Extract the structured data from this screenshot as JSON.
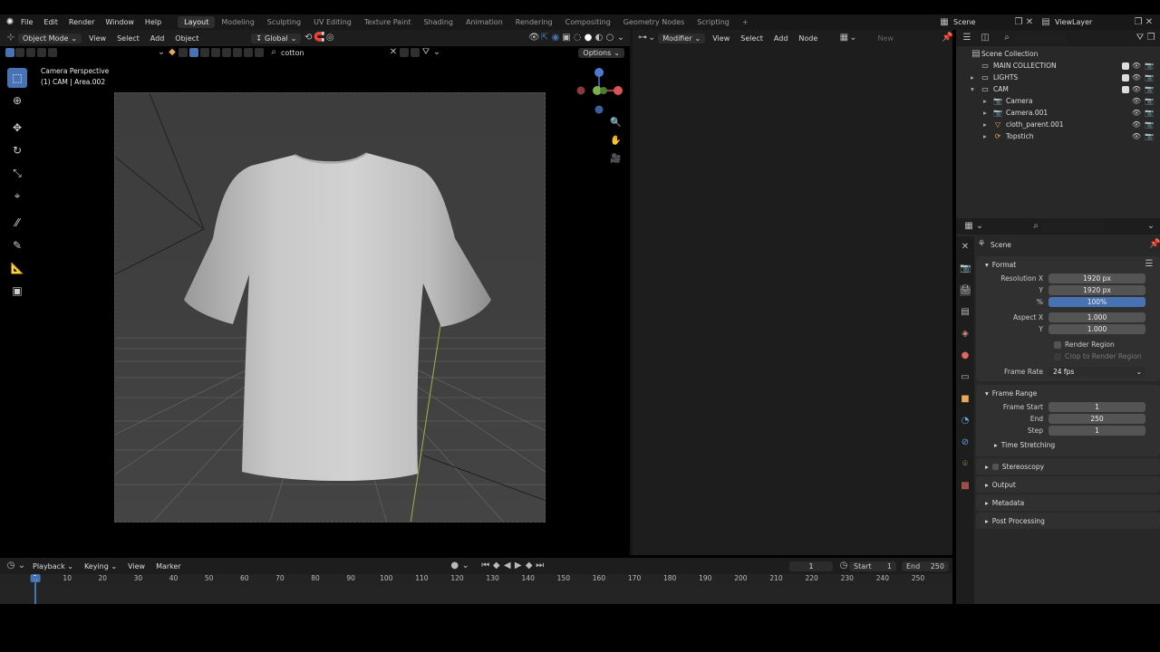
{
  "menu": {
    "items": [
      "File",
      "Edit",
      "Render",
      "Window",
      "Help"
    ],
    "workspaces": [
      "Layout",
      "Modeling",
      "Sculpting",
      "UV Editing",
      "Texture Paint",
      "Shading",
      "Animation",
      "Rendering",
      "Compositing",
      "Geometry Nodes",
      "Scripting"
    ],
    "active_workspace": "Layout",
    "add_tab": "+",
    "scene": "Scene",
    "view_layer": "ViewLayer"
  },
  "viewport": {
    "mode": "Object Mode",
    "menus": [
      "View",
      "Select",
      "Add",
      "Object"
    ],
    "transform": "Global",
    "search_value": "cotton",
    "options_label": "Options",
    "overlay_title": "Camera Perspective",
    "overlay_subtitle": "(1) CAM | Area.002"
  },
  "node_editor": {
    "type": "Modifier",
    "menus": [
      "View",
      "Select",
      "Add",
      "Node"
    ],
    "new_label": "New"
  },
  "outliner": {
    "root": "Scene Collection",
    "items": [
      {
        "label": "MAIN COLLECTION",
        "indent": 0,
        "icon": "collection-icon",
        "arrow": ""
      },
      {
        "label": "LIGHTS",
        "indent": 0,
        "icon": "collection-icon",
        "arrow": "▸"
      },
      {
        "label": "CAM",
        "indent": 0,
        "icon": "collection-icon",
        "arrow": "▾"
      },
      {
        "label": "Camera",
        "indent": 1,
        "icon": "camera-icon",
        "arrow": "▸"
      },
      {
        "label": "Camera.001",
        "indent": 1,
        "icon": "camera-icon",
        "arrow": "▸"
      },
      {
        "label": "cloth_parent.001",
        "indent": 1,
        "icon": "mesh-icon",
        "arrow": "▸"
      },
      {
        "label": "Topstich",
        "indent": 1,
        "icon": "curve-icon",
        "arrow": "▸"
      }
    ]
  },
  "properties": {
    "context": "Scene",
    "format_header": "Format",
    "res_x_label": "Resolution X",
    "res_x": "1920 px",
    "res_y_label": "Y",
    "res_y": "1920 px",
    "res_pct_label": "%",
    "res_pct": "100%",
    "aspect_x_label": "Aspect X",
    "aspect_x": "1.000",
    "aspect_y_label": "Y",
    "aspect_y": "1.000",
    "render_region": "Render Region",
    "crop_region": "Crop to Render Region",
    "frame_rate_label": "Frame Rate",
    "frame_rate": "24 fps",
    "frame_range_header": "Frame Range",
    "frame_start_label": "Frame Start",
    "frame_start": "1",
    "end_label": "End",
    "end": "250",
    "step_label": "Step",
    "step": "1",
    "time_stretching": "Time Stretching",
    "stereoscopy": "Stereoscopy",
    "output": "Output",
    "metadata": "Metadata",
    "post_processing": "Post Processing"
  },
  "timeline": {
    "menus": [
      "Playback",
      "Keying",
      "View",
      "Marker"
    ],
    "current_frame": "1",
    "start_label": "Start",
    "start": "1",
    "end_label": "End",
    "end": "250",
    "ticks": [
      "1",
      "10",
      "20",
      "30",
      "40",
      "50",
      "60",
      "70",
      "80",
      "90",
      "100",
      "110",
      "120",
      "130",
      "140",
      "150",
      "160",
      "170",
      "180",
      "190",
      "200",
      "210",
      "220",
      "230",
      "240",
      "250"
    ]
  },
  "colors": {
    "accent": "#4772b3",
    "panel": "#303030",
    "header": "#1d1d1d"
  }
}
